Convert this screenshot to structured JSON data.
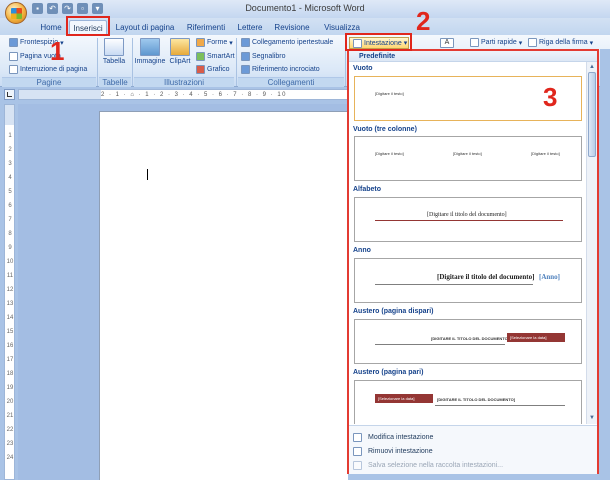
{
  "window": {
    "title": "Documento1 - Microsoft Word"
  },
  "tabs": [
    {
      "label": "Home"
    },
    {
      "label": "Inserisci"
    },
    {
      "label": "Layout di pagina"
    },
    {
      "label": "Riferimenti"
    },
    {
      "label": "Lettere"
    },
    {
      "label": "Revisione"
    },
    {
      "label": "Visualizza"
    }
  ],
  "ribbon": {
    "pagine": {
      "label": "Pagine",
      "frontespizio": "Frontespizio",
      "pagina_vuota": "Pagina vuota",
      "interruzione": "Interruzione di pagina"
    },
    "tabelle": {
      "label": "Tabelle",
      "tabella": "Tabella"
    },
    "illustrazioni": {
      "label": "Illustrazioni",
      "immagine": "Immagine",
      "clipart": "ClipArt",
      "forme": "Forme",
      "smartart": "SmartArt",
      "grafico": "Grafico"
    },
    "collegamenti": {
      "label": "Collegamenti",
      "ipertestuale": "Collegamento ipertestuale",
      "segnalibro": "Segnalibro",
      "incrociato": "Riferimento incrociato"
    },
    "intestazione": "Intestazione",
    "parti_rapide": "Parti rapide",
    "riga_firma": "Riga della firma"
  },
  "gallery": {
    "header": "Predefinite",
    "items": [
      {
        "name": "Vuoto",
        "placeholders": [
          "[Digitare il testo]"
        ]
      },
      {
        "name": "Vuoto (tre colonne)",
        "placeholders": [
          "[Digitare il testo]",
          "[Digitare il testo]",
          "[Digitare il testo]"
        ]
      },
      {
        "name": "Alfabeto",
        "placeholders": [
          "[Digitare il titolo del documento]"
        ]
      },
      {
        "name": "Anno",
        "placeholders": [
          "[Digitare il titolo del documento]",
          "[Anno]"
        ]
      },
      {
        "name": "Austero (pagina dispari)",
        "placeholders": [
          "[DIGITARE IL TITOLO DEL DOCUMENTO]",
          "[Selezionare la data]"
        ]
      },
      {
        "name": "Austero (pagina pari)",
        "placeholders": [
          "[Selezionare la data]",
          "[DIGITARE IL TITOLO DEL DOCUMENTO]"
        ]
      }
    ],
    "menu": {
      "modifica": "Modifica intestazione",
      "rimuovi": "Rimuovi intestazione",
      "salva": "Salva selezione nella raccolta intestazioni..."
    }
  },
  "ruler": {
    "marks": "2 · 1 · ⌂ · 1 · 2 · 3 · 4 · 5 · 6 · 7 · 8 · 9 · 10"
  },
  "vertical_ruler": [
    "1",
    "2",
    "3",
    "4",
    "5",
    "6",
    "7",
    "8",
    "9",
    "10",
    "11",
    "12",
    "13",
    "14",
    "15",
    "16",
    "17",
    "18",
    "19",
    "20",
    "21",
    "22",
    "23",
    "24"
  ],
  "annotations": {
    "step1": "1",
    "step2": "2",
    "step3": "3"
  },
  "colors": {
    "annotation_red": "#e0261c",
    "accent_dark_red": "#943634",
    "header_blue": "#15428b"
  }
}
